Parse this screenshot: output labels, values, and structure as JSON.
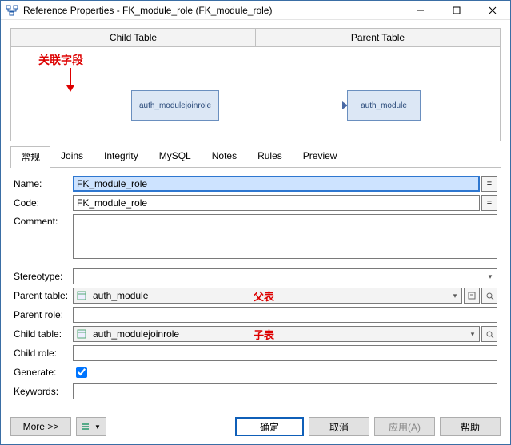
{
  "titlebar": {
    "title": "Reference Properties - FK_module_role (FK_module_role)"
  },
  "split": {
    "child": "Child Table",
    "parent": "Parent Table"
  },
  "diagram": {
    "entity1": "auth_modulejoinrole",
    "entity2": "auth_module"
  },
  "annotation": {
    "text": "关联字段"
  },
  "tabs": {
    "t0": "常规",
    "t1": "Joins",
    "t2": "Integrity",
    "t3": "MySQL",
    "t4": "Notes",
    "t5": "Rules",
    "t6": "Preview"
  },
  "redhints": {
    "parent": "父表",
    "child": "子表"
  },
  "labels": {
    "name": "Name:",
    "code": "Code:",
    "comment": "Comment:",
    "stereotype": "Stereotype:",
    "parenttable": "Parent table:",
    "parentrole": "Parent role:",
    "childtable": "Child table:",
    "childrole": "Child role:",
    "generate": "Generate:",
    "keywords": "Keywords:"
  },
  "values": {
    "name": "FK_module_role",
    "code": "FK_module_role",
    "comment": "",
    "stereotype": "",
    "parenttable": "auth_module",
    "parentrole": "",
    "childtable": "auth_modulejoinrole",
    "childrole": "",
    "generate": true,
    "keywords": ""
  },
  "eqbtn": "=",
  "footer": {
    "more": "More >>",
    "ok": "确定",
    "cancel": "取消",
    "apply": "应用(A)",
    "help": "帮助"
  }
}
